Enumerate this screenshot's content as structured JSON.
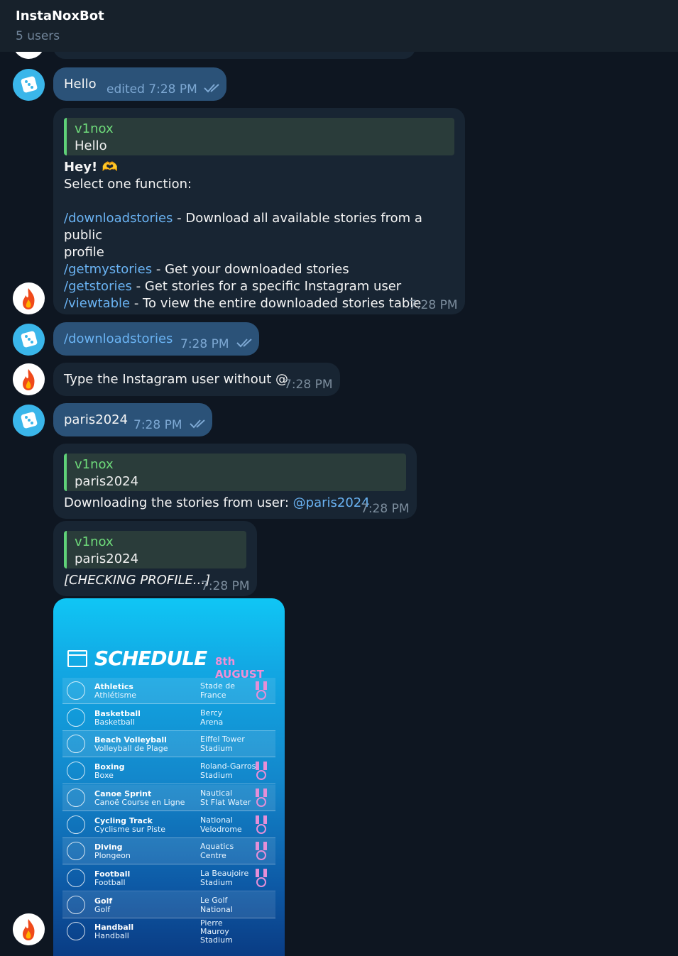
{
  "header": {
    "title": "InstaNoxBot",
    "subtitle": "5 users"
  },
  "messages": {
    "m1": {
      "text": "Hello",
      "edited": "edited 7:28 PM"
    },
    "m2": {
      "quote_name": "v1nox",
      "quote_text": "Hello",
      "greeting": "Hey! 🫶",
      "prompt": "Select one function:",
      "cmd1": "/downloadstories",
      "cmd1_desc": " - Download all available stories from a public",
      "cmd1_desc2": "profile",
      "cmd2": "/getmystories",
      "cmd2_desc": " - Get your downloaded stories",
      "cmd3": "/getstories",
      "cmd3_desc": " - Get stories for a specific Instagram user",
      "cmd4": "/viewtable",
      "cmd4_desc": " - To view the entire downloaded stories table",
      "time": "7:28 PM"
    },
    "m3": {
      "text": "/downloadstories",
      "time": "7:28 PM"
    },
    "m4": {
      "text": "Type the Instagram user without @",
      "time": "7:28 PM"
    },
    "m5": {
      "text": "paris2024",
      "time": "7:28 PM"
    },
    "m6": {
      "quote_name": "v1nox",
      "quote_text": "paris2024",
      "text": "Downloading the stories from user: ",
      "mention": "@paris2024",
      "time": "7:28 PM"
    },
    "m7": {
      "quote_name": "v1nox",
      "quote_text": "paris2024",
      "text": "[CHECKING PROFILE...]",
      "time": "7:28 PM"
    }
  },
  "schedule": {
    "title": "SCHEDULE",
    "date": "8th AUGUST",
    "rows": [
      {
        "en": "Athletics",
        "fr": "Athlétisme",
        "v1": "Stade de",
        "v2": "France",
        "medal": true
      },
      {
        "en": "Basketball",
        "fr": "Basketball",
        "v1": "Bercy",
        "v2": "Arena",
        "medal": false
      },
      {
        "en": "Beach Volleyball",
        "fr": "Volleyball de Plage",
        "v1": "Eiffel Tower",
        "v2": "Stadium",
        "medal": false
      },
      {
        "en": "Boxing",
        "fr": "Boxe",
        "v1": "Roland-Garros",
        "v2": "Stadium",
        "medal": true
      },
      {
        "en": "Canoe Sprint",
        "fr": "Canoë Course en Ligne",
        "v1": "Nautical",
        "v2": "St Flat Water",
        "medal": true
      },
      {
        "en": "Cycling Track",
        "fr": "Cyclisme sur Piste",
        "v1": "National",
        "v2": "Velodrome",
        "medal": true
      },
      {
        "en": "Diving",
        "fr": "Plongeon",
        "v1": "Aquatics",
        "v2": "Centre",
        "medal": true
      },
      {
        "en": "Football",
        "fr": "Football",
        "v1": "La Beaujoire",
        "v2": "Stadium",
        "medal": true
      },
      {
        "en": "Golf",
        "fr": "Golf",
        "v1": "Le Golf",
        "v2": "National",
        "medal": false
      },
      {
        "en": "Handball",
        "fr": "Handball",
        "v1": "Pierre",
        "v2": "Mauroy",
        "v3": "Stadium",
        "medal": false
      }
    ]
  }
}
